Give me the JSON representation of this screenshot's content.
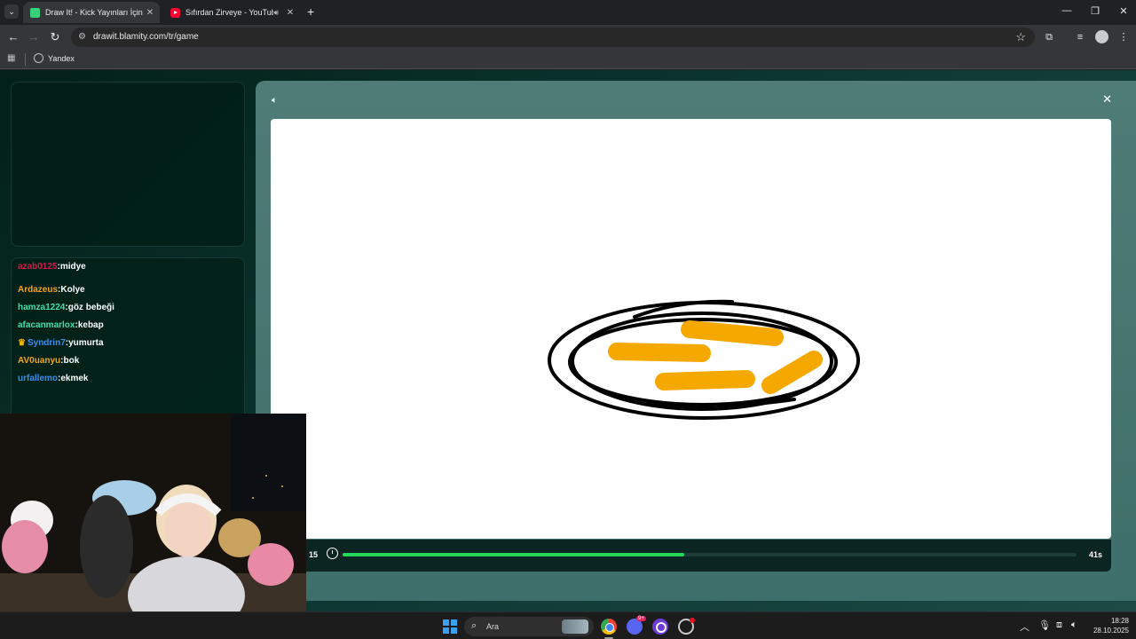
{
  "browser": {
    "tabs": [
      {
        "title": "Draw It! - Kick Yayınları İçin Çizim",
        "active": true
      },
      {
        "title": "Sıfırdan Zirveye - YouTube",
        "active": false
      }
    ],
    "address": "drawit.blamity.com/tr/game",
    "bookmarks": [
      {
        "label": "Yandex"
      }
    ]
  },
  "chat": {
    "messages": [
      {
        "user": "azab0125",
        "message": "midye",
        "color": "#d01a4a"
      },
      {
        "user": "Ardazeus",
        "message": "Kolye",
        "color": "#f2a51a"
      },
      {
        "user": "hamza1224",
        "message": "göz bebeği",
        "color": "#3fe0a8"
      },
      {
        "user": "afacanmarlox",
        "message": "kebap",
        "color": "#3fe0a8"
      },
      {
        "user": "Syndrin7",
        "message": "yumurta",
        "color": "#3a8df0",
        "crown": true
      },
      {
        "user": "AV0uanyu",
        "message": "bok",
        "color": "#f2a51a"
      },
      {
        "user": "urfallemo",
        "message": "ekmek",
        "color": "#3a8df0"
      }
    ]
  },
  "game": {
    "round": "15",
    "seconds_left": "41s",
    "progress": 0.465,
    "colors": {
      "progress": "#25d85a",
      "stroke": "#000000",
      "fill_stroke": "#f5a800"
    }
  },
  "taskbar": {
    "search_placeholder": "Ara",
    "discord_badge": "9+",
    "time": "18:28",
    "date": "28.10.2025"
  },
  "icons": {
    "tab_menu": "chevron-down-icon",
    "back": "arrow-left-icon",
    "forward": "arrow-right-icon",
    "reload": "reload-icon",
    "site_info": "tune-icon",
    "bookmark": "star-icon",
    "extensions": "puzzle-icon",
    "media": "media-control-icon",
    "menu": "kebab-menu-icon",
    "apps": "apps-grid-icon",
    "speaker": "speaker-icon",
    "close": "close-icon",
    "timer": "stopwatch-icon"
  }
}
